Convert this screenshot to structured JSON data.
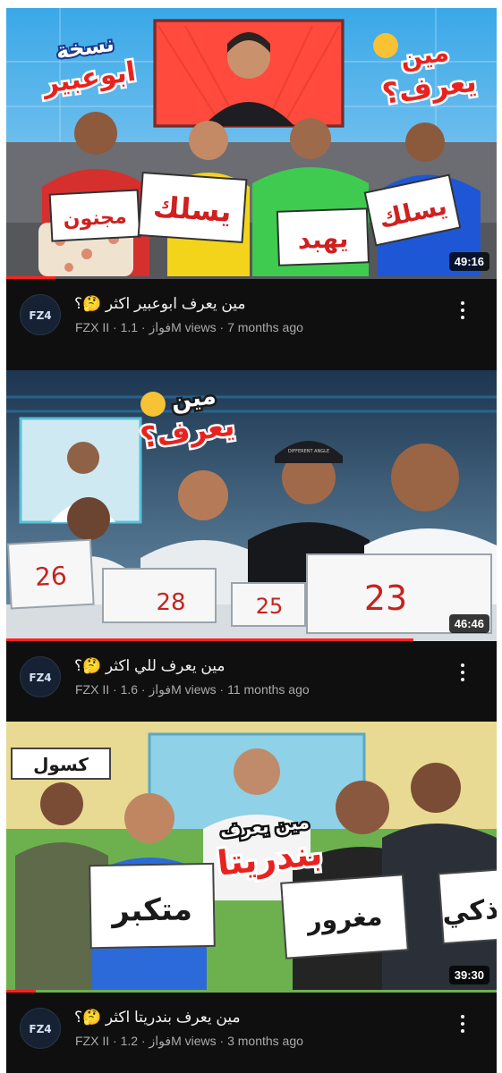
{
  "videos": [
    {
      "title": "مين يعرف ابوعبير اكثر 🤔؟",
      "channel": "FZX II · فواز",
      "views": "1.1M views",
      "age": "7 months ago",
      "duration": "49:16",
      "progress": 0.1,
      "thumb_text": {
        "headline_top": "مين",
        "headline_bottom": "يعرف؟",
        "left_top": "نسخة",
        "left_bottom": "ابوعبير",
        "signs": [
          "مجنون",
          "يسلك",
          "يهبد",
          "يسلك"
        ]
      }
    },
    {
      "title": "مين يعرف للي اكثر 🤔؟",
      "channel": "FZX II · فواز",
      "views": "1.6M views",
      "age": "11 months ago",
      "duration": "46:46",
      "progress": 0.83,
      "thumb_text": {
        "headline_top": "مين",
        "headline_bottom": "يعرف؟",
        "cap_text": "DIFFERENT ANGLE",
        "signs": [
          "26",
          "28",
          "25",
          "23"
        ]
      }
    },
    {
      "title": "مين يعرف بندريتا اكثر 🤔؟",
      "channel": "FZX II · فواز",
      "views": "1.2M views",
      "age": "3 months ago",
      "duration": "39:30",
      "progress": 0.06,
      "thumb_text": {
        "headline_top": "مين يعرف",
        "headline_bottom": "بندريتا",
        "signs": [
          "كسول",
          "متكبر",
          "مغرور",
          "ذكي"
        ]
      }
    }
  ],
  "colors": {
    "accent": "#ff2222",
    "background": "#0f0f0f",
    "meta": "#aaaaaa"
  }
}
